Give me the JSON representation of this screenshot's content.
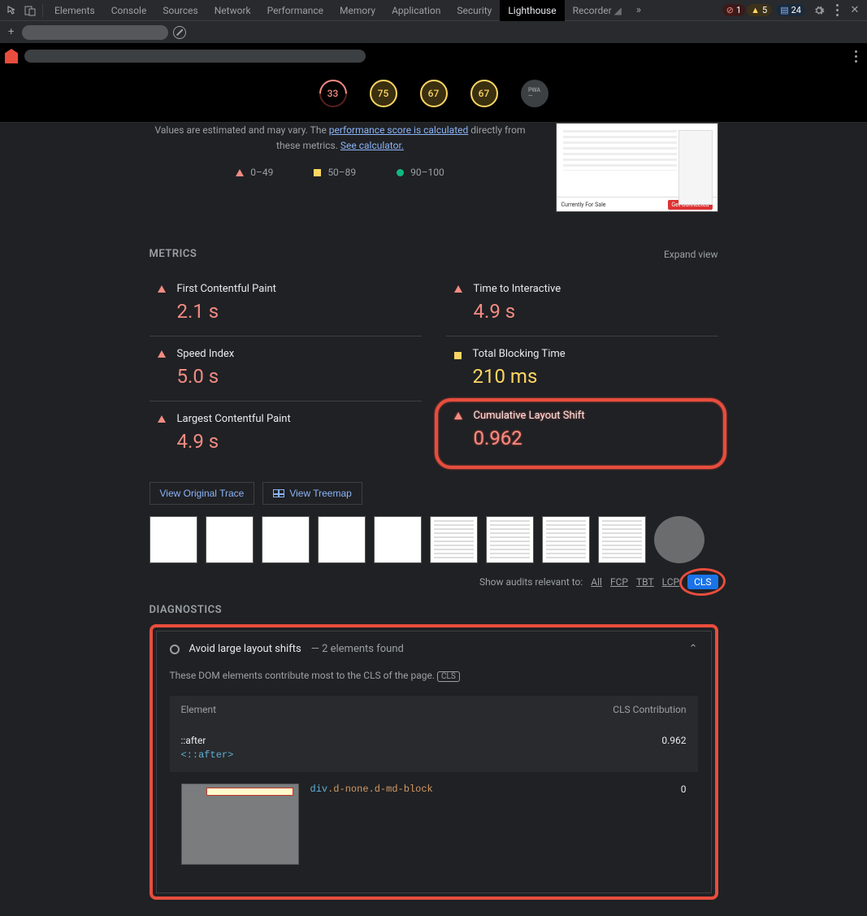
{
  "devtools": {
    "tabs": [
      "Elements",
      "Console",
      "Sources",
      "Network",
      "Performance",
      "Memory",
      "Application",
      "Security",
      "Lighthouse",
      "Recorder"
    ],
    "active_tab": "Lighthouse",
    "errors": "1",
    "warnings": "5",
    "messages": "24"
  },
  "gauges": {
    "performance": "33",
    "accessibility": "75",
    "best_practices": "67",
    "seo": "67",
    "pwa": "—"
  },
  "estimate": {
    "line_prefix": "Values are estimated and may vary. The ",
    "link1": "performance score is calculated",
    "line_mid": " directly from these metrics. ",
    "link2": "See calculator."
  },
  "legend": {
    "low": "0–49",
    "mid": "50–89",
    "high": "90–100"
  },
  "screenshot_footer": {
    "label": "Currently For Sale",
    "btn": "Get Connected"
  },
  "sections": {
    "metrics": "METRICS",
    "expand": "Expand view",
    "diagnostics": "DIAGNOSTICS"
  },
  "metrics": {
    "fcp": {
      "name": "First Contentful Paint",
      "value": "2.1 s"
    },
    "tti": {
      "name": "Time to Interactive",
      "value": "4.9 s"
    },
    "si": {
      "name": "Speed Index",
      "value": "5.0 s"
    },
    "tbt": {
      "name": "Total Blocking Time",
      "value": "210 ms"
    },
    "lcp": {
      "name": "Largest Contentful Paint",
      "value": "4.9 s"
    },
    "cls": {
      "name": "Cumulative Layout Shift",
      "value": "0.962"
    }
  },
  "buttons": {
    "trace": "View Original Trace",
    "treemap": "View Treemap"
  },
  "audit_filter": {
    "label": "Show audits relevant to:",
    "all": "All",
    "fcp": "FCP",
    "tbt": "TBT",
    "lcp": "LCP",
    "cls": "CLS"
  },
  "diag": {
    "title": "Avoid large layout shifts",
    "count_sep": " — ",
    "count": "2 elements found",
    "desc": "These DOM elements contribute most to the CLS of the page. ",
    "cls_label": "CLS",
    "col_element": "Element",
    "col_contrib": "CLS Contribution",
    "row1": {
      "name": "::after",
      "code": "<::after>",
      "value": "0.962"
    },
    "row2": {
      "code_tag": "div",
      "code_cls": ".d-none.d-md-block",
      "value": "0"
    }
  }
}
